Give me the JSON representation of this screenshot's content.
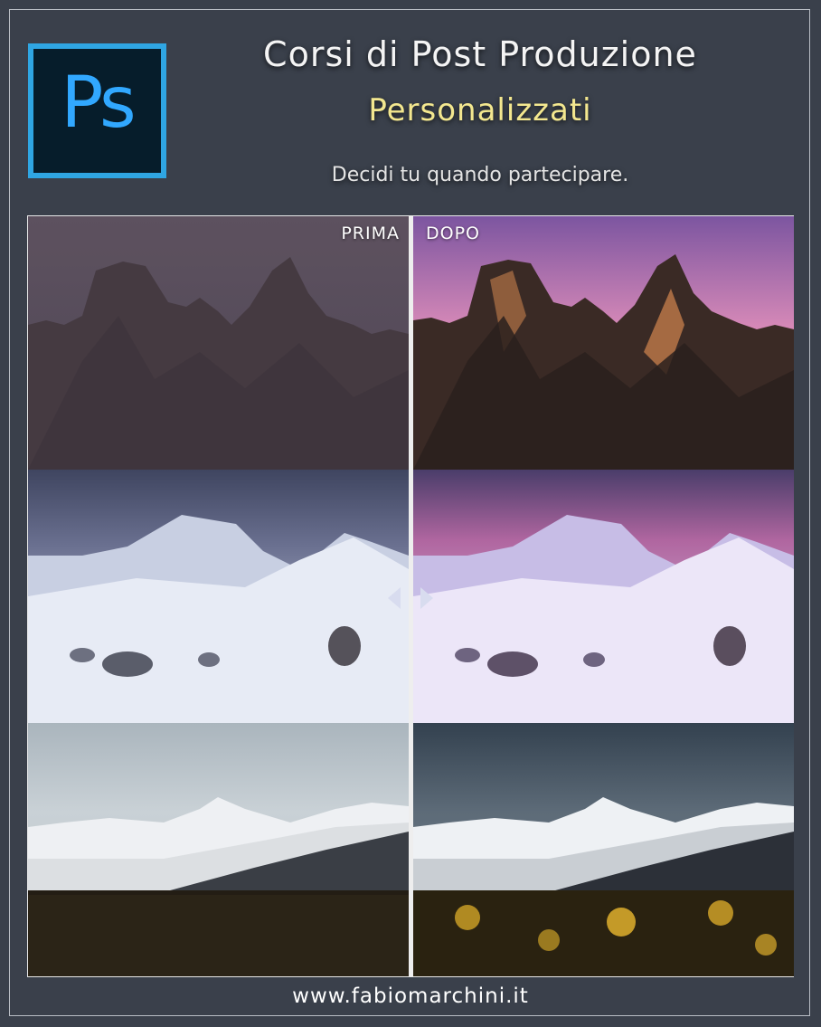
{
  "logo": {
    "text": "Ps",
    "border_color": "#2fa6e3",
    "text_color": "#31a8ff",
    "bg_color": "#061d2b"
  },
  "header": {
    "title": "Corsi di Post Produzione",
    "subtitle": "Personalizzati",
    "tagline": "Decidi tu quando partecipare."
  },
  "comparison": {
    "before_label": "PRIMA",
    "after_label": "DOPO",
    "rows": [
      {
        "subject": "mountain-peaks"
      },
      {
        "subject": "snowy-landscape"
      },
      {
        "subject": "mountains-and-forest"
      }
    ]
  },
  "footer": {
    "url": "www.fabiomarchini.it"
  },
  "colors": {
    "background": "#3a404b",
    "accent_yellow": "#f3e78f"
  }
}
